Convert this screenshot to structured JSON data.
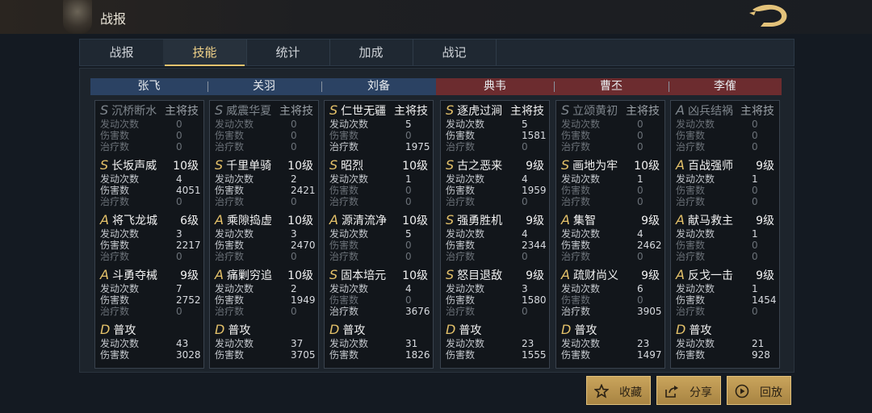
{
  "header": {
    "title": "战报"
  },
  "tabs": [
    {
      "label": "战报"
    },
    {
      "label": "技能"
    },
    {
      "label": "统计"
    },
    {
      "label": "加成"
    },
    {
      "label": "战记"
    }
  ],
  "heroes": [
    {
      "name": "张飞",
      "side": "blue"
    },
    {
      "name": "关羽",
      "side": "blue"
    },
    {
      "name": "刘备",
      "side": "blue"
    },
    {
      "name": "典韦",
      "side": "red"
    },
    {
      "name": "曹丕",
      "side": "red"
    },
    {
      "name": "李傕",
      "side": "red"
    }
  ],
  "columns": [
    {
      "skills": [
        {
          "grade": "S",
          "name": "沉桥断水",
          "level": "主将技",
          "dim": true,
          "stats": [
            {
              "label": "发动次数",
              "value": "0",
              "dim": true
            },
            {
              "label": "伤害数",
              "value": "0",
              "dim": true
            },
            {
              "label": "治疗数",
              "value": "0",
              "dim": true
            }
          ]
        },
        {
          "grade": "S",
          "name": "长坂声威",
          "level": "10级",
          "stats": [
            {
              "label": "发动次数",
              "value": "4"
            },
            {
              "label": "伤害数",
              "value": "4051"
            },
            {
              "label": "治疗数",
              "value": "0",
              "dim": true
            }
          ]
        },
        {
          "grade": "A",
          "name": "将飞龙城",
          "level": "6级",
          "stats": [
            {
              "label": "发动次数",
              "value": "3"
            },
            {
              "label": "伤害数",
              "value": "2217"
            },
            {
              "label": "治疗数",
              "value": "0",
              "dim": true
            }
          ]
        },
        {
          "grade": "A",
          "name": "斗勇夺械",
          "level": "9级",
          "stats": [
            {
              "label": "发动次数",
              "value": "7"
            },
            {
              "label": "伤害数",
              "value": "2752"
            },
            {
              "label": "治疗数",
              "value": "0",
              "dim": true
            }
          ]
        },
        {
          "grade": "D",
          "name": "普攻",
          "level": "",
          "stats": [
            {
              "label": "发动次数",
              "value": "43"
            },
            {
              "label": "伤害数",
              "value": "3028"
            }
          ]
        }
      ]
    },
    {
      "skills": [
        {
          "grade": "S",
          "name": "威震华夏",
          "level": "主将技",
          "dim": true,
          "stats": [
            {
              "label": "发动次数",
              "value": "0",
              "dim": true
            },
            {
              "label": "伤害数",
              "value": "0",
              "dim": true
            },
            {
              "label": "治疗数",
              "value": "0",
              "dim": true
            }
          ]
        },
        {
          "grade": "S",
          "name": "千里单骑",
          "level": "10级",
          "stats": [
            {
              "label": "发动次数",
              "value": "2"
            },
            {
              "label": "伤害数",
              "value": "2421"
            },
            {
              "label": "治疗数",
              "value": "0",
              "dim": true
            }
          ]
        },
        {
          "grade": "A",
          "name": "乘隙捣虚",
          "level": "10级",
          "stats": [
            {
              "label": "发动次数",
              "value": "3"
            },
            {
              "label": "伤害数",
              "value": "2470"
            },
            {
              "label": "治疗数",
              "value": "0",
              "dim": true
            }
          ]
        },
        {
          "grade": "A",
          "name": "痛剿穷追",
          "level": "10级",
          "stats": [
            {
              "label": "发动次数",
              "value": "2"
            },
            {
              "label": "伤害数",
              "value": "1949"
            },
            {
              "label": "治疗数",
              "value": "0",
              "dim": true
            }
          ]
        },
        {
          "grade": "D",
          "name": "普攻",
          "level": "",
          "stats": [
            {
              "label": "发动次数",
              "value": "37"
            },
            {
              "label": "伤害数",
              "value": "3705"
            }
          ]
        }
      ]
    },
    {
      "skills": [
        {
          "grade": "S",
          "name": "仁世无疆",
          "level": "主将技",
          "stats": [
            {
              "label": "发动次数",
              "value": "5"
            },
            {
              "label": "伤害数",
              "value": "0",
              "dim": true
            },
            {
              "label": "治疗数",
              "value": "1975"
            }
          ]
        },
        {
          "grade": "S",
          "name": "昭烈",
          "level": "10级",
          "stats": [
            {
              "label": "发动次数",
              "value": "1"
            },
            {
              "label": "伤害数",
              "value": "0",
              "dim": true
            },
            {
              "label": "治疗数",
              "value": "0",
              "dim": true
            }
          ]
        },
        {
          "grade": "A",
          "name": "源清流净",
          "level": "10级",
          "stats": [
            {
              "label": "发动次数",
              "value": "5"
            },
            {
              "label": "伤害数",
              "value": "0",
              "dim": true
            },
            {
              "label": "治疗数",
              "value": "0",
              "dim": true
            }
          ]
        },
        {
          "grade": "S",
          "name": "固本培元",
          "level": "10级",
          "stats": [
            {
              "label": "发动次数",
              "value": "4"
            },
            {
              "label": "伤害数",
              "value": "0",
              "dim": true
            },
            {
              "label": "治疗数",
              "value": "3676"
            }
          ]
        },
        {
          "grade": "D",
          "name": "普攻",
          "level": "",
          "stats": [
            {
              "label": "发动次数",
              "value": "31"
            },
            {
              "label": "伤害数",
              "value": "1826"
            }
          ]
        }
      ]
    },
    {
      "skills": [
        {
          "grade": "S",
          "name": "逐虎过涧",
          "level": "主将技",
          "stats": [
            {
              "label": "发动次数",
              "value": "5"
            },
            {
              "label": "伤害数",
              "value": "1581"
            },
            {
              "label": "治疗数",
              "value": "0",
              "dim": true
            }
          ]
        },
        {
          "grade": "S",
          "name": "古之恶来",
          "level": "9级",
          "stats": [
            {
              "label": "发动次数",
              "value": "4"
            },
            {
              "label": "伤害数",
              "value": "1959"
            },
            {
              "label": "治疗数",
              "value": "0",
              "dim": true
            }
          ]
        },
        {
          "grade": "S",
          "name": "强勇胜机",
          "level": "9级",
          "stats": [
            {
              "label": "发动次数",
              "value": "4"
            },
            {
              "label": "伤害数",
              "value": "2344"
            },
            {
              "label": "治疗数",
              "value": "0",
              "dim": true
            }
          ]
        },
        {
          "grade": "S",
          "name": "怒目退敌",
          "level": "9级",
          "stats": [
            {
              "label": "发动次数",
              "value": "3"
            },
            {
              "label": "伤害数",
              "value": "1580"
            },
            {
              "label": "治疗数",
              "value": "0",
              "dim": true
            }
          ]
        },
        {
          "grade": "D",
          "name": "普攻",
          "level": "",
          "stats": [
            {
              "label": "发动次数",
              "value": "23"
            },
            {
              "label": "伤害数",
              "value": "1555"
            }
          ]
        }
      ]
    },
    {
      "skills": [
        {
          "grade": "S",
          "name": "立颂黄初",
          "level": "主将技",
          "dim": true,
          "stats": [
            {
              "label": "发动次数",
              "value": "0",
              "dim": true
            },
            {
              "label": "伤害数",
              "value": "0",
              "dim": true
            },
            {
              "label": "治疗数",
              "value": "0",
              "dim": true
            }
          ]
        },
        {
          "grade": "S",
          "name": "画地为牢",
          "level": "10级",
          "stats": [
            {
              "label": "发动次数",
              "value": "1"
            },
            {
              "label": "伤害数",
              "value": "0",
              "dim": true
            },
            {
              "label": "治疗数",
              "value": "0",
              "dim": true
            }
          ]
        },
        {
          "grade": "A",
          "name": "集智",
          "level": "9级",
          "stats": [
            {
              "label": "发动次数",
              "value": "4"
            },
            {
              "label": "伤害数",
              "value": "2462"
            },
            {
              "label": "治疗数",
              "value": "0",
              "dim": true
            }
          ]
        },
        {
          "grade": "A",
          "name": "疏财尚义",
          "level": "9级",
          "stats": [
            {
              "label": "发动次数",
              "value": "6"
            },
            {
              "label": "伤害数",
              "value": "0",
              "dim": true
            },
            {
              "label": "治疗数",
              "value": "3905"
            }
          ]
        },
        {
          "grade": "D",
          "name": "普攻",
          "level": "",
          "stats": [
            {
              "label": "发动次数",
              "value": "23"
            },
            {
              "label": "伤害数",
              "value": "1497"
            }
          ]
        }
      ]
    },
    {
      "skills": [
        {
          "grade": "A",
          "name": "凶兵结祸",
          "level": "主将技",
          "dim": true,
          "stats": [
            {
              "label": "发动次数",
              "value": "0",
              "dim": true
            },
            {
              "label": "伤害数",
              "value": "0",
              "dim": true
            },
            {
              "label": "治疗数",
              "value": "0",
              "dim": true
            }
          ]
        },
        {
          "grade": "A",
          "name": "百战强师",
          "level": "9级",
          "stats": [
            {
              "label": "发动次数",
              "value": "1"
            },
            {
              "label": "伤害数",
              "value": "0",
              "dim": true
            },
            {
              "label": "治疗数",
              "value": "0",
              "dim": true
            }
          ]
        },
        {
          "grade": "A",
          "name": "献马救主",
          "level": "9级",
          "stats": [
            {
              "label": "发动次数",
              "value": "1"
            },
            {
              "label": "伤害数",
              "value": "0",
              "dim": true
            },
            {
              "label": "治疗数",
              "value": "0",
              "dim": true
            }
          ]
        },
        {
          "grade": "A",
          "name": "反戈一击",
          "level": "9级",
          "stats": [
            {
              "label": "发动次数",
              "value": "1"
            },
            {
              "label": "伤害数",
              "value": "1454"
            },
            {
              "label": "治疗数",
              "value": "0",
              "dim": true
            }
          ]
        },
        {
          "grade": "D",
          "name": "普攻",
          "level": "",
          "stats": [
            {
              "label": "发动次数",
              "value": "21"
            },
            {
              "label": "伤害数",
              "value": "928"
            }
          ]
        }
      ]
    }
  ],
  "actions": [
    {
      "label": "收藏",
      "icon": "star-icon"
    },
    {
      "label": "分享",
      "icon": "share-icon"
    },
    {
      "label": "回放",
      "icon": "play-icon"
    }
  ]
}
